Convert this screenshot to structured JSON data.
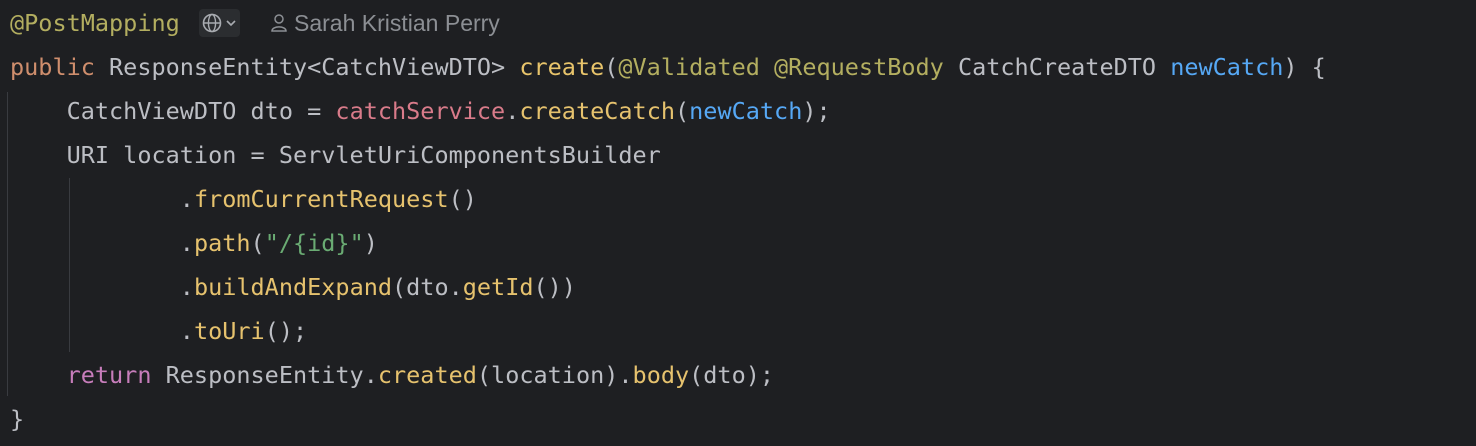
{
  "editor": {
    "language": "Java",
    "theme_background": "#1e1f22",
    "inlay_hint": {
      "endpoints_icon": "globe-icon",
      "dropdown_icon": "chevron-down-icon",
      "author_icon": "person-icon",
      "author": "Sarah Kristian Perry"
    },
    "lines": [
      {
        "annotation": "@PostMapping"
      },
      {
        "t0": "public",
        "t1": " ResponseEntity<CatchViewDTO> ",
        "t2": "create",
        "t3": "(",
        "t4": "@Validated",
        "t5": " ",
        "t6": "@RequestBody",
        "t7": " CatchCreateDTO ",
        "t8": "newCatch",
        "t9": ") {"
      },
      {
        "t0": "    CatchViewDTO dto = ",
        "t1": "catchService",
        "t2": ".",
        "t3": "createCatch",
        "t4": "(",
        "t5": "newCatch",
        "t6": ");"
      },
      {
        "t0": "    URI location = ServletUriComponentsBuilder"
      },
      {
        "t0": "            .",
        "t1": "fromCurrentRequest",
        "t2": "()"
      },
      {
        "t0": "            .",
        "t1": "path",
        "t2": "(",
        "t3": "\"/{id}\"",
        "t4": ")"
      },
      {
        "t0": "            .",
        "t1": "buildAndExpand",
        "t2": "(dto.",
        "t3": "getId",
        "t4": "())"
      },
      {
        "t0": "            .",
        "t1": "toUri",
        "t2": "();"
      },
      {
        "t0": "    ",
        "t1": "return",
        "t2": " ResponseEntity.",
        "t3": "created",
        "t4": "(location).",
        "t5": "body",
        "t6": "(dto);"
      },
      {
        "t0": "}"
      }
    ]
  }
}
